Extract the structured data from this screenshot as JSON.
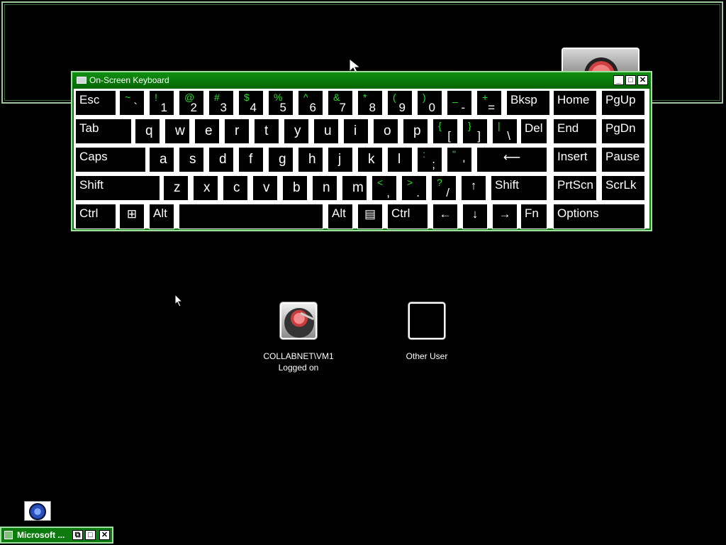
{
  "osk": {
    "title": "On-Screen Keyboard",
    "controls": {
      "minimize": "_",
      "maximize": "□",
      "close": "✕"
    },
    "rows": [
      [
        {
          "id": "esc",
          "label": "Esc"
        },
        {
          "id": "backtick",
          "sym": "~",
          "main": "`"
        },
        {
          "id": "1",
          "sym": "!",
          "main": "1"
        },
        {
          "id": "2",
          "sym": "@",
          "main": "2"
        },
        {
          "id": "3",
          "sym": "#",
          "main": "3"
        },
        {
          "id": "4",
          "sym": "$",
          "main": "4"
        },
        {
          "id": "5",
          "sym": "%",
          "main": "5"
        },
        {
          "id": "6",
          "sym": "^",
          "main": "6"
        },
        {
          "id": "7",
          "sym": "&",
          "main": "7"
        },
        {
          "id": "8",
          "sym": "*",
          "main": "8"
        },
        {
          "id": "9",
          "sym": "(",
          "main": "9"
        },
        {
          "id": "0",
          "sym": ")",
          "main": "0"
        },
        {
          "id": "minus",
          "sym": "_",
          "main": "-"
        },
        {
          "id": "equals",
          "sym": "+",
          "main": "="
        },
        {
          "id": "bksp",
          "label": "Bksp"
        },
        {
          "id": "home",
          "label": "Home"
        },
        {
          "id": "pgup",
          "label": "PgUp"
        }
      ],
      [
        {
          "id": "tab",
          "label": "Tab"
        },
        {
          "id": "q",
          "label": "q"
        },
        {
          "id": "w",
          "label": "w"
        },
        {
          "id": "e",
          "label": "e"
        },
        {
          "id": "r",
          "label": "r"
        },
        {
          "id": "t",
          "label": "t"
        },
        {
          "id": "y",
          "label": "y"
        },
        {
          "id": "u",
          "label": "u"
        },
        {
          "id": "i",
          "label": "i"
        },
        {
          "id": "o",
          "label": "o"
        },
        {
          "id": "p",
          "label": "p"
        },
        {
          "id": "lbracket",
          "sym": "{",
          "main": "["
        },
        {
          "id": "rbracket",
          "sym": "}",
          "main": "]"
        },
        {
          "id": "backslash",
          "sym": "|",
          "main": "\\"
        },
        {
          "id": "del",
          "label": "Del"
        },
        {
          "id": "end",
          "label": "End"
        },
        {
          "id": "pgdn",
          "label": "PgDn"
        }
      ],
      [
        {
          "id": "caps",
          "label": "Caps"
        },
        {
          "id": "a",
          "label": "a"
        },
        {
          "id": "s",
          "label": "s"
        },
        {
          "id": "d",
          "label": "d"
        },
        {
          "id": "f",
          "label": "f"
        },
        {
          "id": "g",
          "label": "g"
        },
        {
          "id": "h",
          "label": "h"
        },
        {
          "id": "j",
          "label": "j"
        },
        {
          "id": "k",
          "label": "k"
        },
        {
          "id": "l",
          "label": "l"
        },
        {
          "id": "semicolon",
          "sym": ":",
          "main": ";"
        },
        {
          "id": "quote",
          "sym": "\"",
          "main": "'"
        },
        {
          "id": "enter",
          "label": "⟵"
        },
        {
          "id": "insert",
          "label": "Insert"
        },
        {
          "id": "pause",
          "label": "Pause"
        }
      ],
      [
        {
          "id": "lshift",
          "label": "Shift"
        },
        {
          "id": "z",
          "label": "z"
        },
        {
          "id": "x",
          "label": "x"
        },
        {
          "id": "c",
          "label": "c"
        },
        {
          "id": "v",
          "label": "v"
        },
        {
          "id": "b",
          "label": "b"
        },
        {
          "id": "n",
          "label": "n"
        },
        {
          "id": "m",
          "label": "m"
        },
        {
          "id": "comma",
          "sym": "<",
          "main": ","
        },
        {
          "id": "period",
          "sym": ">",
          "main": "."
        },
        {
          "id": "slash",
          "sym": "?",
          "main": "/"
        },
        {
          "id": "up",
          "label": "↑"
        },
        {
          "id": "rshift",
          "label": "Shift"
        },
        {
          "id": "prtscn",
          "label": "PrtScn"
        },
        {
          "id": "scrlk",
          "label": "ScrLk"
        }
      ],
      [
        {
          "id": "lctrl",
          "label": "Ctrl"
        },
        {
          "id": "win",
          "label": "⊞"
        },
        {
          "id": "lalt",
          "label": "Alt"
        },
        {
          "id": "space",
          "label": ""
        },
        {
          "id": "ralt",
          "label": "Alt"
        },
        {
          "id": "menu",
          "label": "▤"
        },
        {
          "id": "rctrl",
          "label": "Ctrl"
        },
        {
          "id": "left",
          "label": "←"
        },
        {
          "id": "down",
          "label": "↓"
        },
        {
          "id": "right",
          "label": "→"
        },
        {
          "id": "fn",
          "label": "Fn"
        },
        {
          "id": "options",
          "label": "Options"
        }
      ]
    ]
  },
  "users": [
    {
      "line1": "COLLABNET\\VM1",
      "line2": "Logged on",
      "icon": "turntable-avatar-icon"
    },
    {
      "line1": "Other User",
      "line2": "",
      "icon": "blank-avatar-icon"
    }
  ],
  "taskbar": {
    "item_label": "Microsoft ...",
    "controls": {
      "restore": "⧉",
      "maximize": "□",
      "close": "✕"
    }
  },
  "accessibility": {
    "icon": "ease-of-access-icon"
  }
}
